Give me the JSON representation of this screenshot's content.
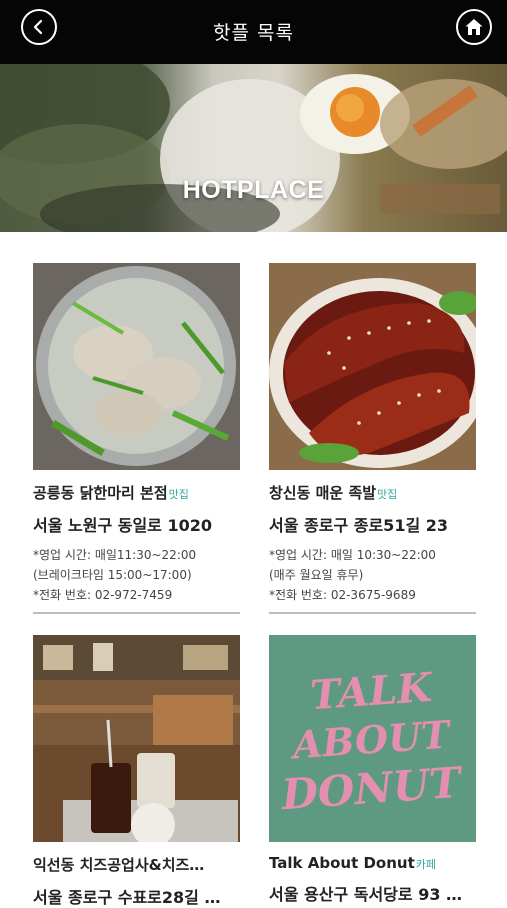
{
  "header": {
    "title": "핫플 목록",
    "back_icon": "chevron-left-icon",
    "home_icon": "home-icon"
  },
  "hero": {
    "title": "HOTPLACE"
  },
  "places": [
    {
      "name": "공릉동 닭한마리 본점",
      "category": "맛집",
      "address": "서울 노원구 동일로 1020",
      "hours": "*영업 시간: 매일11:30~22:00",
      "hours_note": "(브레이크타임 15:00~17:00)",
      "phone": "*전화 번호: 02-972-7459"
    },
    {
      "name": "창신동 매운 족발",
      "category": "맛집",
      "address": "서울 종로구 종로51길 23",
      "hours": "*영업 시간: 매일 10:30~22:00",
      "hours_note": "(매주 월요일 휴무)",
      "phone": "*전화 번호: 02-3675-9689"
    },
    {
      "name": "익선동 치즈공업사&치즈…",
      "category": "",
      "address": "서울 종로구 수표로28길 …"
    },
    {
      "name": "Talk About Donut",
      "category": "카페",
      "address": "서울 용산구 독서당로 93 …",
      "logo_text": [
        "TALK",
        "ABOUT",
        "DONUT"
      ]
    }
  ],
  "colors": {
    "topbar": "#050505",
    "category_tag": "#2fa6a0",
    "donut_bg": "#5e9a82",
    "donut_text": "#e58fb0"
  }
}
